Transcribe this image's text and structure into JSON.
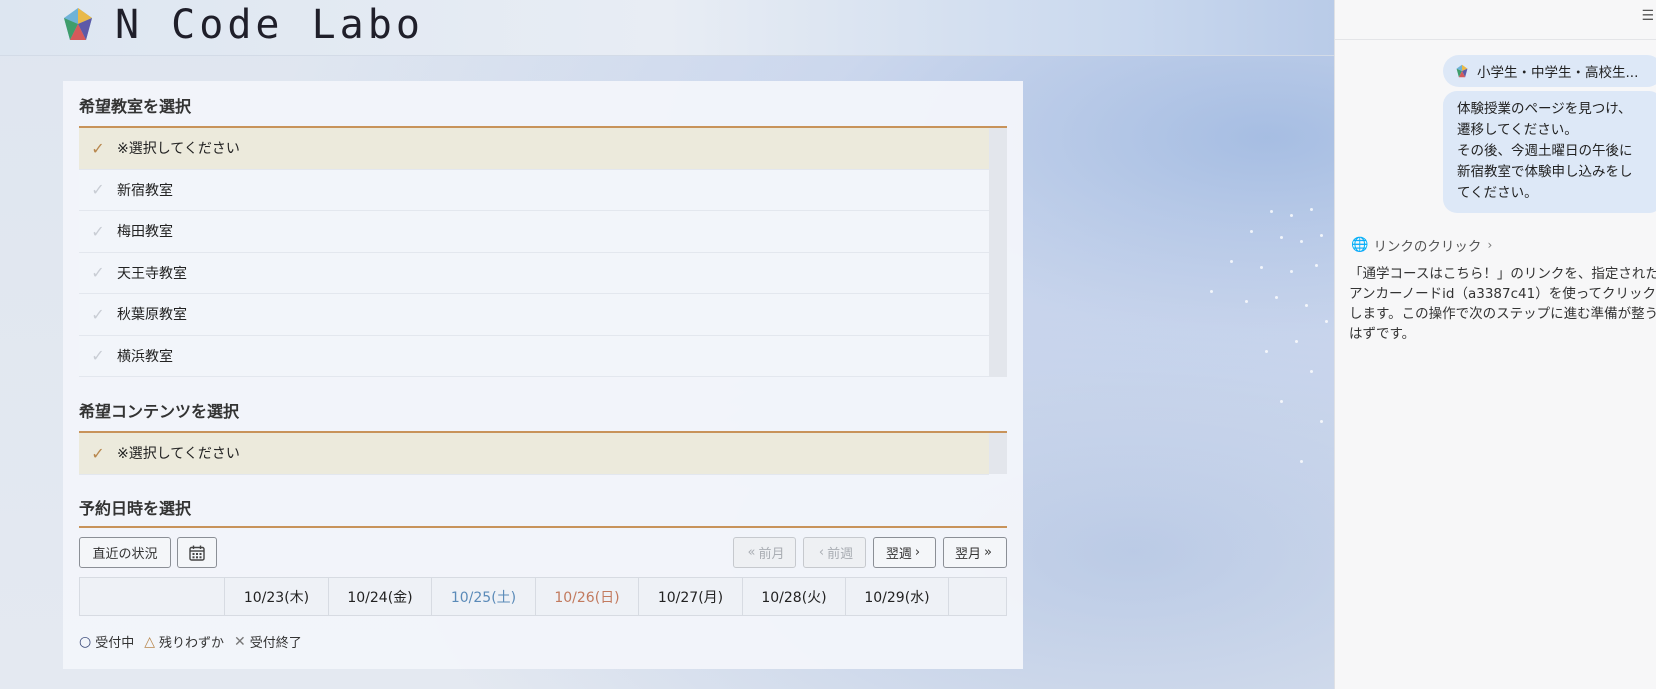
{
  "header": {
    "logo_text": "N Code Labo"
  },
  "classroom": {
    "title": "希望教室を選択",
    "items": [
      {
        "label": "※選択してください",
        "selected": true
      },
      {
        "label": "新宿教室",
        "selected": false
      },
      {
        "label": "梅田教室",
        "selected": false
      },
      {
        "label": "天王寺教室",
        "selected": false
      },
      {
        "label": "秋葉原教室",
        "selected": false
      },
      {
        "label": "横浜教室",
        "selected": false
      }
    ]
  },
  "content": {
    "title": "希望コンテンツを選択",
    "items": [
      {
        "label": "※選択してください",
        "selected": true
      }
    ]
  },
  "schedule": {
    "title": "予約日時を選択",
    "recent_label": "直近の状況",
    "prev_month_label": "前月",
    "prev_week_label": "前週",
    "next_week_label": "翌週",
    "next_month_label": "翌月",
    "dates": [
      {
        "label": "10/23(木)",
        "kind": "weekday"
      },
      {
        "label": "10/24(金)",
        "kind": "weekday"
      },
      {
        "label": "10/25(土)",
        "kind": "sat"
      },
      {
        "label": "10/26(日)",
        "kind": "sun"
      },
      {
        "label": "10/27(月)",
        "kind": "weekday"
      },
      {
        "label": "10/28(火)",
        "kind": "weekday"
      },
      {
        "label": "10/29(水)",
        "kind": "weekday"
      }
    ],
    "legend": {
      "open": "受付中",
      "few": "残りわずか",
      "closed": "受付終了"
    }
  },
  "chat": {
    "chip_text": "小学生・中学生・高校生...",
    "user_message": "体験授業のページを見つけ、\n遷移してください。\nその後、今週土曜日の午後に\n新宿教室で体験申し込みをし\nてください。",
    "action_label": "リンクのクリック",
    "note": "「通学コースはこちら！」のリンクを、指定されたアンカーノードid（a3387c41）を使ってクリックします。この操作で次のステップに進む準備が整うはずです。"
  },
  "colors": {
    "accent_line": "#c8935a",
    "selected_row": "#eceadc",
    "saturday": "#5a8ab8",
    "sunday": "#c27a5e",
    "chat_bubble": "#dde8f7"
  }
}
